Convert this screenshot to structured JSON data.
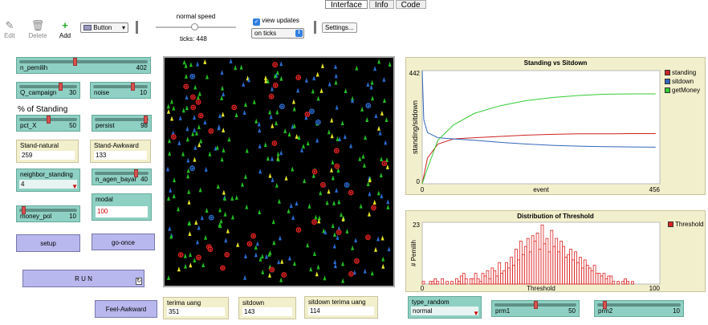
{
  "tabs": [
    "Interface",
    "Info",
    "Code"
  ],
  "toolbar": {
    "edit": "Edit",
    "delete": "Delete",
    "add": "Add",
    "widget_type": "Button",
    "speed_label": "normal speed",
    "ticks_label": "ticks: 448",
    "view_updates": "view updates",
    "update_mode": "on ticks",
    "settings": "Settings..."
  },
  "widgets": {
    "n_pemilih": {
      "label": "n_pemilih",
      "value": "402"
    },
    "q_campaign": {
      "label": "Q_campaign",
      "value": "30"
    },
    "noise": {
      "label": "noise",
      "value": "10"
    },
    "pct_heading": "% of Standing",
    "pct_x": {
      "label": "pct_X",
      "value": "50"
    },
    "persist": {
      "label": "persist",
      "value": "98"
    },
    "stand_natural": {
      "label": "Stand-natural",
      "value": "259"
    },
    "stand_awkward": {
      "label": "Stand-Awkward",
      "value": "133"
    },
    "neighbor_standing": {
      "label": "neighbor_standing",
      "value": "4"
    },
    "n_agen_bayar": {
      "label": "n_agen_bayar",
      "value": "40"
    },
    "modal": {
      "label": "modal",
      "value": "100"
    },
    "money_pol": {
      "label": "money_pol",
      "value": "10"
    },
    "setup": "setup",
    "go_once": "go-once",
    "run": "R U N",
    "feel_awkward": "Feel-Awkward",
    "terima_uang": {
      "label": "terima uang",
      "value": "351"
    },
    "sitdown": {
      "label": "sitdown",
      "value": "143"
    },
    "sitdown_terima_uang": {
      "label": "sitdown terima uang",
      "value": "114"
    },
    "type_random": {
      "label": "type_random",
      "value": "normal"
    },
    "prm1": {
      "label": "prm1",
      "value": "50"
    },
    "prm2": {
      "label": "prm2",
      "value": "10"
    }
  },
  "colors": {
    "standing": "#cc2222",
    "sitdown": "#3366bb",
    "getMoney": "#33cc33",
    "threshold": "#dd2222"
  },
  "chart_data": [
    {
      "type": "line",
      "title": "Standing vs Sitdown",
      "xlabel": "event",
      "ylabel": "standing/sitdown",
      "xlim": [
        0,
        456
      ],
      "ylim": [
        0,
        442
      ],
      "x_ticks": [
        "0",
        "456"
      ],
      "y_ticks": [
        "0",
        "442"
      ],
      "legend": "top-right",
      "series": [
        {
          "name": "standing",
          "x": [
            0,
            10,
            30,
            60,
            100,
            150,
            200,
            250,
            300,
            350,
            400,
            448
          ],
          "y": [
            0,
            100,
            155,
            175,
            180,
            185,
            190,
            193,
            195,
            195,
            196,
            196
          ]
        },
        {
          "name": "sitdown",
          "x": [
            0,
            3,
            10,
            30,
            60,
            100,
            150,
            200,
            250,
            300,
            350,
            400,
            448
          ],
          "y": [
            442,
            250,
            200,
            180,
            175,
            170,
            162,
            155,
            150,
            147,
            145,
            144,
            143
          ]
        },
        {
          "name": "getMoney",
          "x": [
            0,
            10,
            30,
            60,
            100,
            150,
            200,
            250,
            300,
            350,
            400,
            448
          ],
          "y": [
            0,
            60,
            170,
            230,
            275,
            305,
            325,
            337,
            345,
            350,
            351,
            351
          ]
        }
      ]
    },
    {
      "type": "bar",
      "title": "Distribution of Threshold",
      "xlabel": "Threshold",
      "ylabel": "# Pemilih",
      "xlim": [
        0,
        100
      ],
      "ylim": [
        0,
        23
      ],
      "x_ticks": [
        "0",
        "100"
      ],
      "y_ticks": [
        "0",
        "23"
      ],
      "legend": "top-right",
      "series": [
        {
          "name": "Threshold",
          "x": [
            0,
            2,
            3,
            4,
            5,
            6,
            8,
            10,
            12,
            14,
            15,
            16,
            17,
            18,
            20,
            21,
            22,
            23,
            24,
            25,
            26,
            27,
            28,
            29,
            30,
            31,
            32,
            33,
            34,
            35,
            36,
            37,
            38,
            39,
            40,
            41,
            42,
            43,
            44,
            45,
            46,
            47,
            48,
            49,
            50,
            51,
            52,
            53,
            54,
            55,
            56,
            57,
            58,
            59,
            60,
            61,
            62,
            63,
            64,
            65,
            66,
            67,
            68,
            69,
            70,
            71,
            72,
            73,
            74,
            75,
            76,
            77,
            78,
            79,
            80,
            82,
            84,
            85,
            86,
            88
          ],
          "y": [
            1,
            0,
            1,
            1,
            2,
            1,
            2,
            1,
            1,
            2,
            1,
            3,
            4,
            2,
            2,
            2,
            4,
            2,
            1,
            4,
            3,
            5,
            2,
            6,
            5,
            3,
            8,
            4,
            5,
            8,
            6,
            10,
            7,
            13,
            9,
            16,
            11,
            14,
            17,
            12,
            18,
            16,
            19,
            13,
            22,
            15,
            17,
            12,
            20,
            14,
            17,
            12,
            16,
            14,
            10,
            11,
            13,
            9,
            12,
            8,
            10,
            6,
            9,
            7,
            6,
            5,
            7,
            4,
            4,
            3,
            4,
            2,
            3,
            3,
            1,
            1,
            1,
            2,
            1,
            1
          ]
        }
      ]
    }
  ]
}
